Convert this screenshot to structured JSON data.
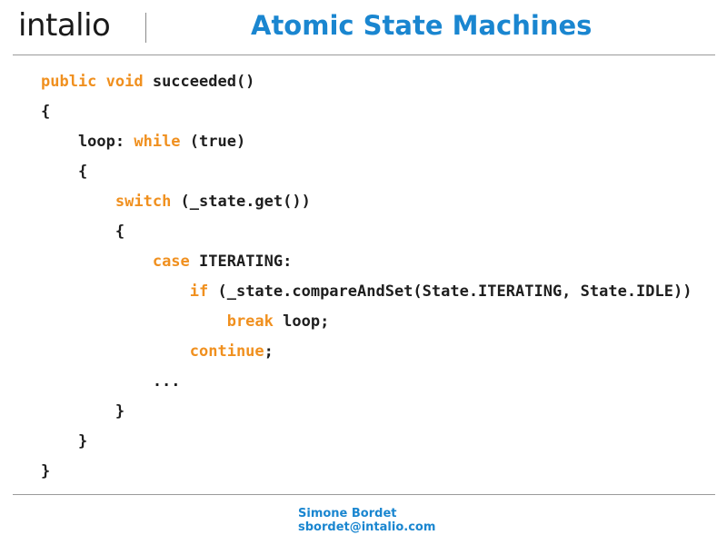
{
  "header": {
    "logo": "intalio",
    "title": "Atomic State Machines"
  },
  "code": [
    [
      {
        "t": "public void ",
        "k": true
      },
      {
        "t": "succeeded()",
        "k": false
      }
    ],
    [
      {
        "t": "{",
        "k": false
      }
    ],
    [
      {
        "t": "    loop: ",
        "k": false
      },
      {
        "t": "while",
        "k": true
      },
      {
        "t": " (true)",
        "k": false
      }
    ],
    [
      {
        "t": "    {",
        "k": false
      }
    ],
    [
      {
        "t": "        ",
        "k": false
      },
      {
        "t": "switch",
        "k": true
      },
      {
        "t": " (_state.get())",
        "k": false
      }
    ],
    [
      {
        "t": "        {",
        "k": false
      }
    ],
    [
      {
        "t": "            ",
        "k": false
      },
      {
        "t": "case",
        "k": true
      },
      {
        "t": " ITERATING:",
        "k": false
      }
    ],
    [
      {
        "t": "                ",
        "k": false
      },
      {
        "t": "if",
        "k": true
      },
      {
        "t": " (_state.compareAndSet(State.ITERATING, State.IDLE))",
        "k": false
      }
    ],
    [
      {
        "t": "                    ",
        "k": false
      },
      {
        "t": "break",
        "k": true
      },
      {
        "t": " loop;",
        "k": false
      }
    ],
    [
      {
        "t": "                ",
        "k": false
      },
      {
        "t": "continue",
        "k": true
      },
      {
        "t": ";",
        "k": false
      }
    ],
    [
      {
        "t": "            ...",
        "k": false
      }
    ],
    [
      {
        "t": "        }",
        "k": false
      }
    ],
    [
      {
        "t": "    }",
        "k": false
      }
    ],
    [
      {
        "t": "}",
        "k": false
      }
    ]
  ],
  "footer": {
    "author": "Simone Bordet",
    "email": "sbordet@intalio.com"
  },
  "colors": {
    "title": "#1a86d0",
    "keyword": "#f0901f",
    "code_text": "#1e1e1e",
    "rule": "#9a9a9a"
  }
}
